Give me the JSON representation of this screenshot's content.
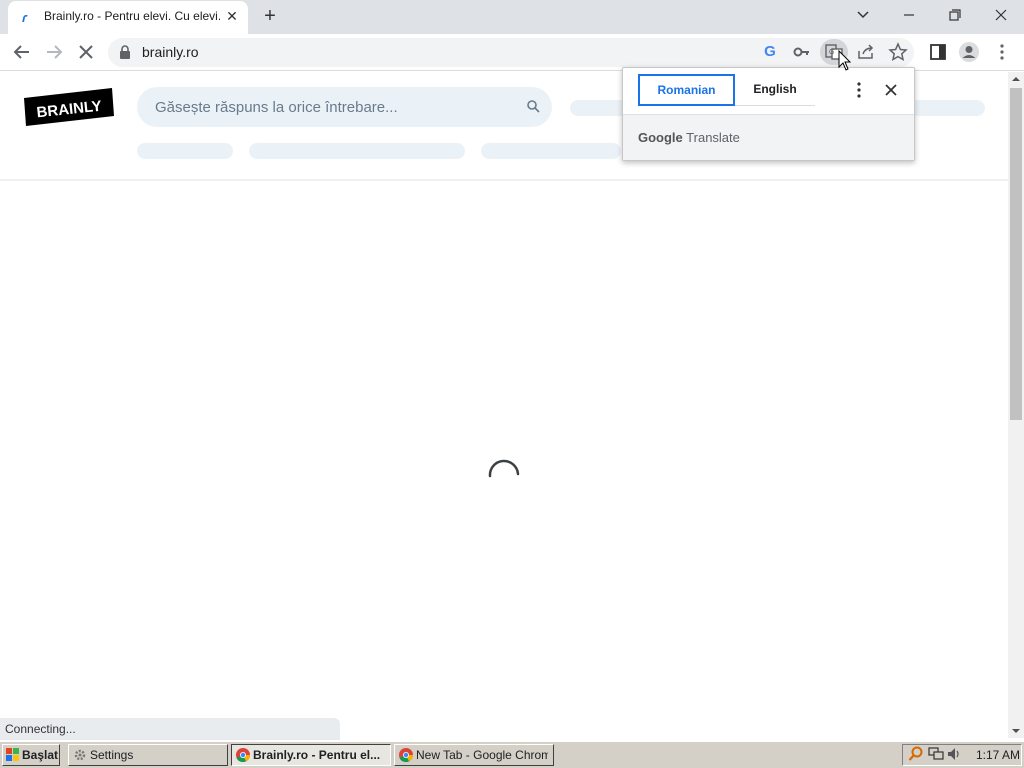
{
  "browser": {
    "tab_title": "Brainly.ro - Pentru elevi. Cu elevi.",
    "tab_favicon": "brainly-favicon",
    "url": "brainly.ro",
    "status_text": "Connecting...",
    "icons": [
      "back-icon",
      "forward-icon",
      "stop-icon",
      "lock-icon",
      "google-icon",
      "key-icon",
      "translate-icon",
      "share-icon",
      "star-icon",
      "side-panel-icon",
      "profile-icon",
      "menu-icon"
    ]
  },
  "page": {
    "logo_text": "BRAINLY",
    "search_placeholder": "Găsește răspuns la orice întrebare..."
  },
  "translate_popup": {
    "source_language": "Romanian",
    "target_language": "English",
    "footer_google": "Google",
    "footer_translate": "Translate"
  },
  "taskbar": {
    "start_label": "Başlat",
    "tasks": [
      {
        "label": "Settings",
        "active": false
      },
      {
        "label": "Brainly.ro - Pentru el...",
        "active": true
      },
      {
        "label": "New Tab - Google Chrome",
        "active": false
      }
    ],
    "clock": "1:17 AM"
  },
  "colors": {
    "accent": "#1a73e8",
    "titlebar": "#dee1e6",
    "taskbar": "#d4d0c8",
    "skeleton": "#ebf2f7"
  }
}
